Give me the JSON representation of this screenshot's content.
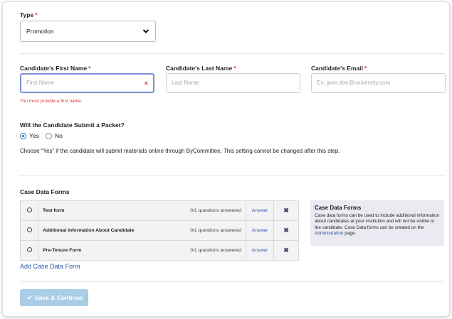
{
  "type": {
    "label": "Type",
    "required_mark": "*",
    "value": "Promotion"
  },
  "first_name": {
    "label": "Candidate's First Name",
    "required_mark": "*",
    "placeholder": "First Name",
    "error": "You must provide a first name.",
    "clear_icon": "×"
  },
  "last_name": {
    "label": "Candidate's Last Name",
    "required_mark": "*",
    "placeholder": "Last Name"
  },
  "email": {
    "label": "Candidate's Email",
    "required_mark": "*",
    "placeholder": "Ex: jane.doe@university.com"
  },
  "packet": {
    "question": "Will the Candidate Submit a Packet?",
    "options": [
      {
        "label": "Yes",
        "selected": true
      },
      {
        "label": "No",
        "selected": false
      }
    ],
    "help": "Choose “Yes” if the candidate will submit materials online through ByCommittee. This setting cannot be changed after this step."
  },
  "case_data": {
    "heading": "Case Data Forms",
    "forms": [
      {
        "name": "Test form",
        "status": "0/1 questions answered",
        "action": "Answer"
      },
      {
        "name": "Additional Information About Candidate",
        "status": "0/1 questions answered",
        "action": "Answer"
      },
      {
        "name": "Pre-Tenure Form",
        "status": "0/1 questions answered",
        "action": "Answer"
      }
    ],
    "add_link": "Add Case Data Form",
    "info": {
      "title": "Case Data Forms",
      "text_before": "Case data forms can be used to include additional information about candidates at your institution and will not be visible to the candidate. Case Data forms can be created on the ",
      "link": "Administration",
      "text_after": " page."
    }
  },
  "submit": {
    "label": "Save & Continue"
  },
  "colors": {
    "accent": "#2b5aa6",
    "error": "#dd3333",
    "button_disabled": "#a9cde6",
    "panel_bg": "#ebe9f1"
  }
}
